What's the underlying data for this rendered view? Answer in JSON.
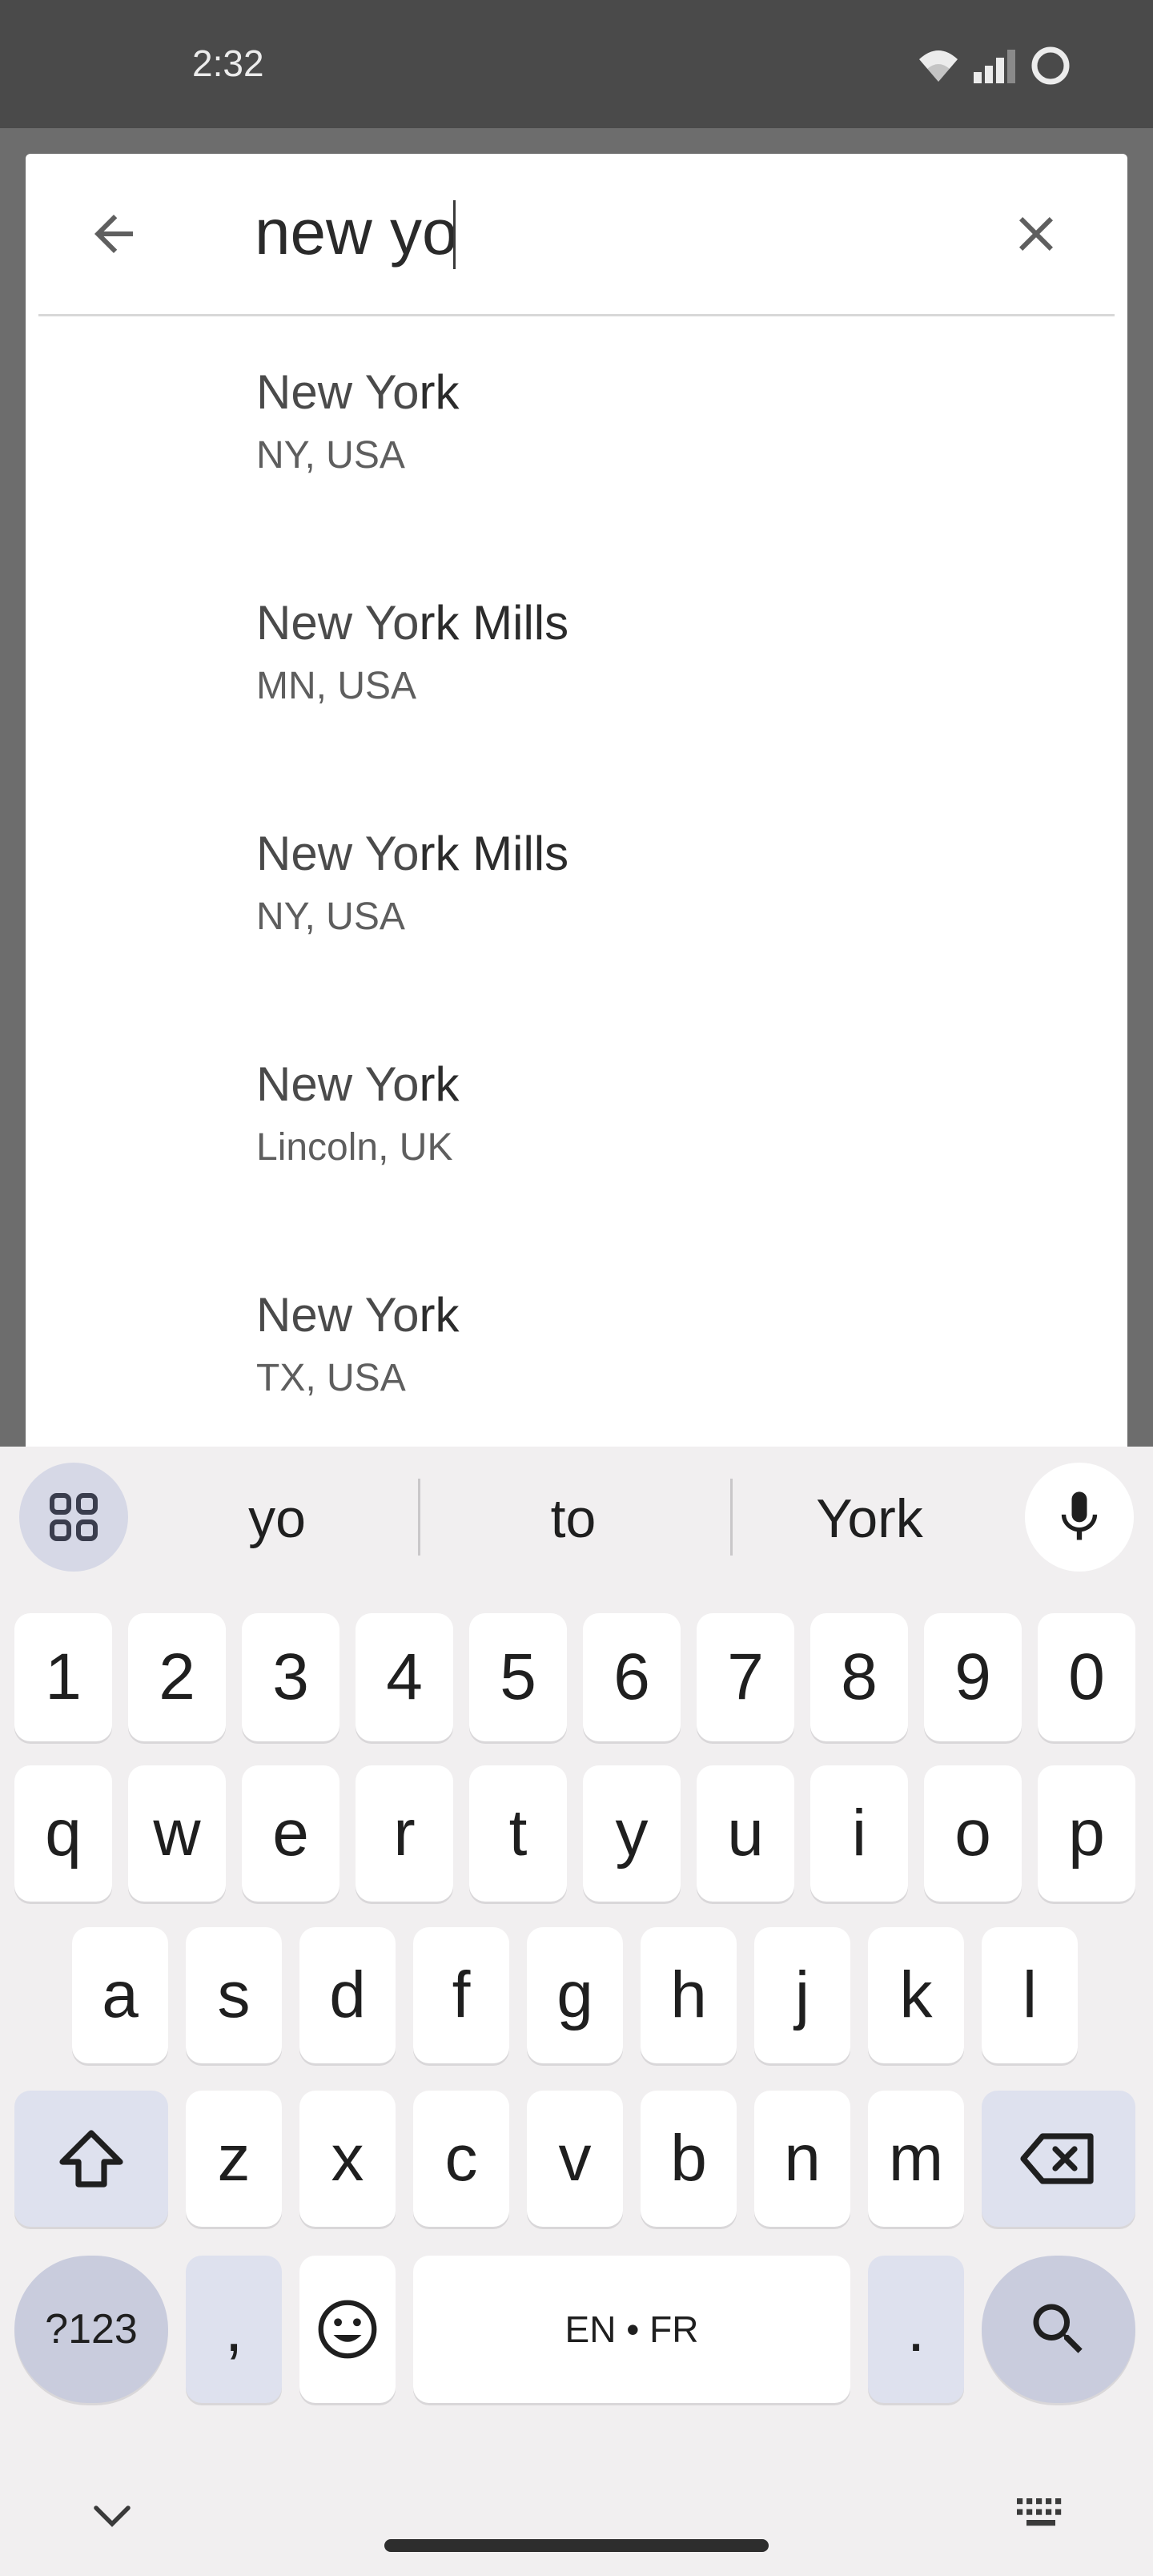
{
  "status_bar": {
    "time": "2:32",
    "icons": [
      "wifi-icon",
      "signal-icon",
      "battery-icon"
    ]
  },
  "search": {
    "query": "new yo",
    "back_icon": "arrow-left-icon",
    "clear_icon": "close-icon"
  },
  "results": [
    {
      "name_prefix": "New Yo",
      "name_rest": "rk",
      "subtitle": "NY, USA"
    },
    {
      "name_prefix": "New Yo",
      "name_rest": "rk Mills",
      "subtitle": "MN, USA"
    },
    {
      "name_prefix": "New Yo",
      "name_rest": "rk Mills",
      "subtitle": "NY, USA"
    },
    {
      "name_prefix": "New Yo",
      "name_rest": "rk",
      "subtitle": "Lincoln, UK"
    },
    {
      "name_prefix": "New Yo",
      "name_rest": "rk",
      "subtitle": "TX, USA"
    }
  ],
  "keyboard": {
    "suggestions": [
      "yo",
      "to",
      "York"
    ],
    "row_numbers": [
      "1",
      "2",
      "3",
      "4",
      "5",
      "6",
      "7",
      "8",
      "9",
      "0"
    ],
    "row1": [
      "q",
      "w",
      "e",
      "r",
      "t",
      "y",
      "u",
      "i",
      "o",
      "p"
    ],
    "row2": [
      "a",
      "s",
      "d",
      "f",
      "g",
      "h",
      "j",
      "k",
      "l"
    ],
    "row3": [
      "z",
      "x",
      "c",
      "v",
      "b",
      "n",
      "m"
    ],
    "symbols_label": "?123",
    "comma": ",",
    "space_label": "EN • FR",
    "period": ".",
    "icons": [
      "apps-grid-icon",
      "microphone-icon",
      "shift-icon",
      "backspace-icon",
      "emoji-icon",
      "search-icon",
      "chevron-down-icon",
      "keyboard-icon"
    ]
  },
  "colors": {
    "status_bar": "#4a4a4a",
    "overlay": "#6d6d6d",
    "keyboard_bg": "#f1eff0",
    "modifier_key": "#dee1ee",
    "action_key": "#c9ccdd"
  }
}
